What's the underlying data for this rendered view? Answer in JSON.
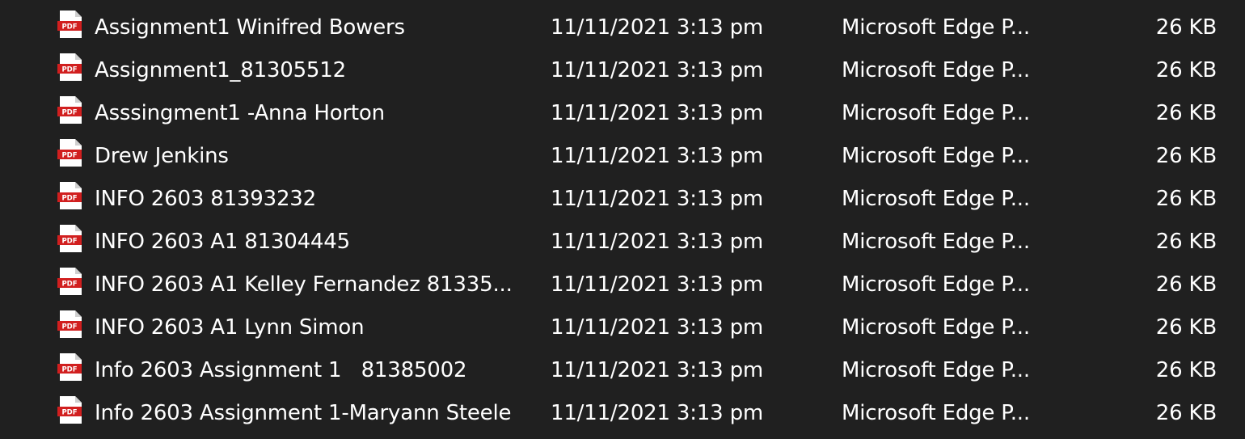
{
  "accent_colors": {
    "background": "#202020",
    "text": "#ffffff",
    "pdf_icon_red": "#d11f1f"
  },
  "file_icon": "pdf-file-icon",
  "pdf_badge_text": "PDF",
  "files": [
    {
      "name": "Assignment1 Winifred Bowers",
      "date": "11/11/2021 3:13 pm",
      "type": "Microsoft Edge P...",
      "size": "26 KB"
    },
    {
      "name": "Assignment1_81305512",
      "date": "11/11/2021 3:13 pm",
      "type": "Microsoft Edge P...",
      "size": "26 KB"
    },
    {
      "name": "Asssingment1 -Anna Horton",
      "date": "11/11/2021 3:13 pm",
      "type": "Microsoft Edge P...",
      "size": "26 KB"
    },
    {
      "name": "Drew Jenkins",
      "date": "11/11/2021 3:13 pm",
      "type": "Microsoft Edge P...",
      "size": "26 KB"
    },
    {
      "name": "INFO 2603 81393232",
      "date": "11/11/2021 3:13 pm",
      "type": "Microsoft Edge P...",
      "size": "26 KB"
    },
    {
      "name": "INFO 2603 A1 81304445",
      "date": "11/11/2021 3:13 pm",
      "type": "Microsoft Edge P...",
      "size": "26 KB"
    },
    {
      "name": "INFO 2603 A1 Kelley Fernandez 81335...",
      "date": "11/11/2021 3:13 pm",
      "type": "Microsoft Edge P...",
      "size": "26 KB"
    },
    {
      "name": "INFO 2603 A1 Lynn Simon",
      "date": "11/11/2021 3:13 pm",
      "type": "Microsoft Edge P...",
      "size": "26 KB"
    },
    {
      "name": "Info 2603 Assignment 1   81385002",
      "date": "11/11/2021 3:13 pm",
      "type": "Microsoft Edge P...",
      "size": "26 KB"
    },
    {
      "name": "Info 2603 Assignment 1-Maryann Steele",
      "date": "11/11/2021 3:13 pm",
      "type": "Microsoft Edge P...",
      "size": "26 KB"
    }
  ]
}
